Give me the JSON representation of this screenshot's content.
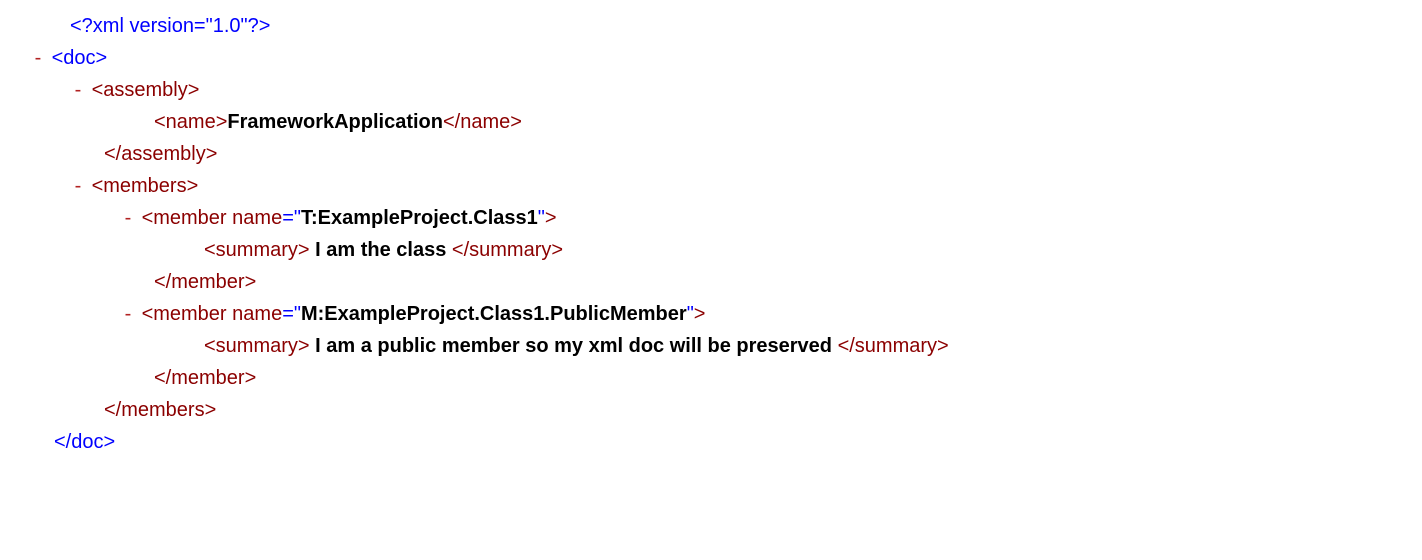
{
  "xmlDecl": "<?xml version=\"1.0\"?>",
  "tags": {
    "docOpen": "<doc>",
    "docClose": "</doc>",
    "assemblyOpen": "<assembly>",
    "assemblyClose": "</assembly>",
    "nameOpen": "<name>",
    "nameClose": "</name>",
    "membersOpen": "<members>",
    "membersClose": "</members>",
    "memberOpenStart": "<member",
    "memberClose": "</member>",
    "summaryOpen": "<summary>",
    "summaryClose": "</summary>",
    "close": ">"
  },
  "attr": {
    "nameLabel": "name"
  },
  "values": {
    "assemblyName": "FrameworkApplication",
    "member1Name": "T:ExampleProject.Class1",
    "member1Summary": " I am the class ",
    "member2Name": "M:ExampleProject.Class1.PublicMember",
    "member2Summary": " I am a public member so my xml doc will be preserved "
  },
  "toggle": "-",
  "punct": {
    "equals": "=",
    "quote": "\"",
    "space": " "
  }
}
